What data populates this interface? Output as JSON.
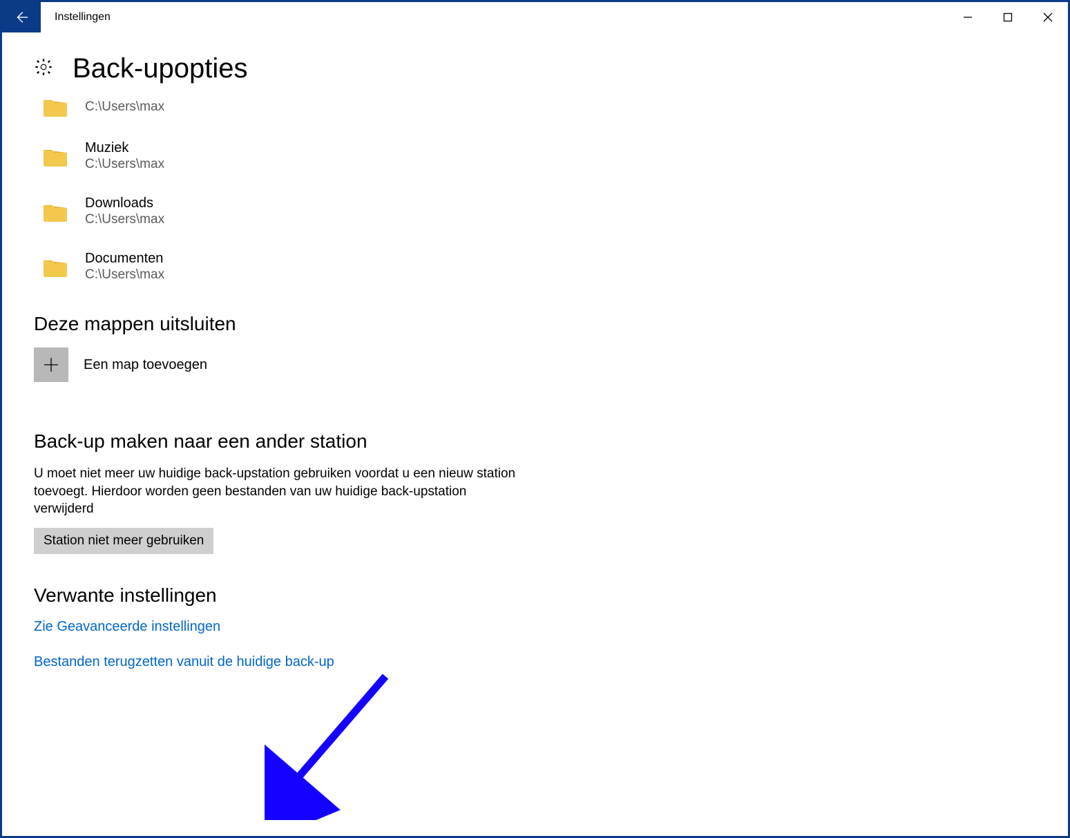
{
  "window": {
    "title": "Instellingen"
  },
  "page": {
    "heading": "Back-upopties"
  },
  "folders": [
    {
      "name": "",
      "path": "C:\\Users\\max"
    },
    {
      "name": "Muziek",
      "path": "C:\\Users\\max"
    },
    {
      "name": "Downloads",
      "path": "C:\\Users\\max"
    },
    {
      "name": "Documenten",
      "path": "C:\\Users\\max"
    }
  ],
  "exclude": {
    "heading": "Deze mappen uitsluiten",
    "add_label": "Een map toevoegen"
  },
  "other_drive": {
    "heading": "Back-up maken naar een ander station",
    "description": "U moet niet meer uw huidige back-upstation gebruiken voordat u een nieuw station toevoegt. Hierdoor worden geen bestanden van uw huidige back-upstation verwijderd",
    "stop_button": "Station niet meer gebruiken"
  },
  "related": {
    "heading": "Verwante instellingen",
    "link_advanced": "Zie Geavanceerde instellingen",
    "link_restore": "Bestanden terugzetten vanuit de huidige back-up"
  }
}
